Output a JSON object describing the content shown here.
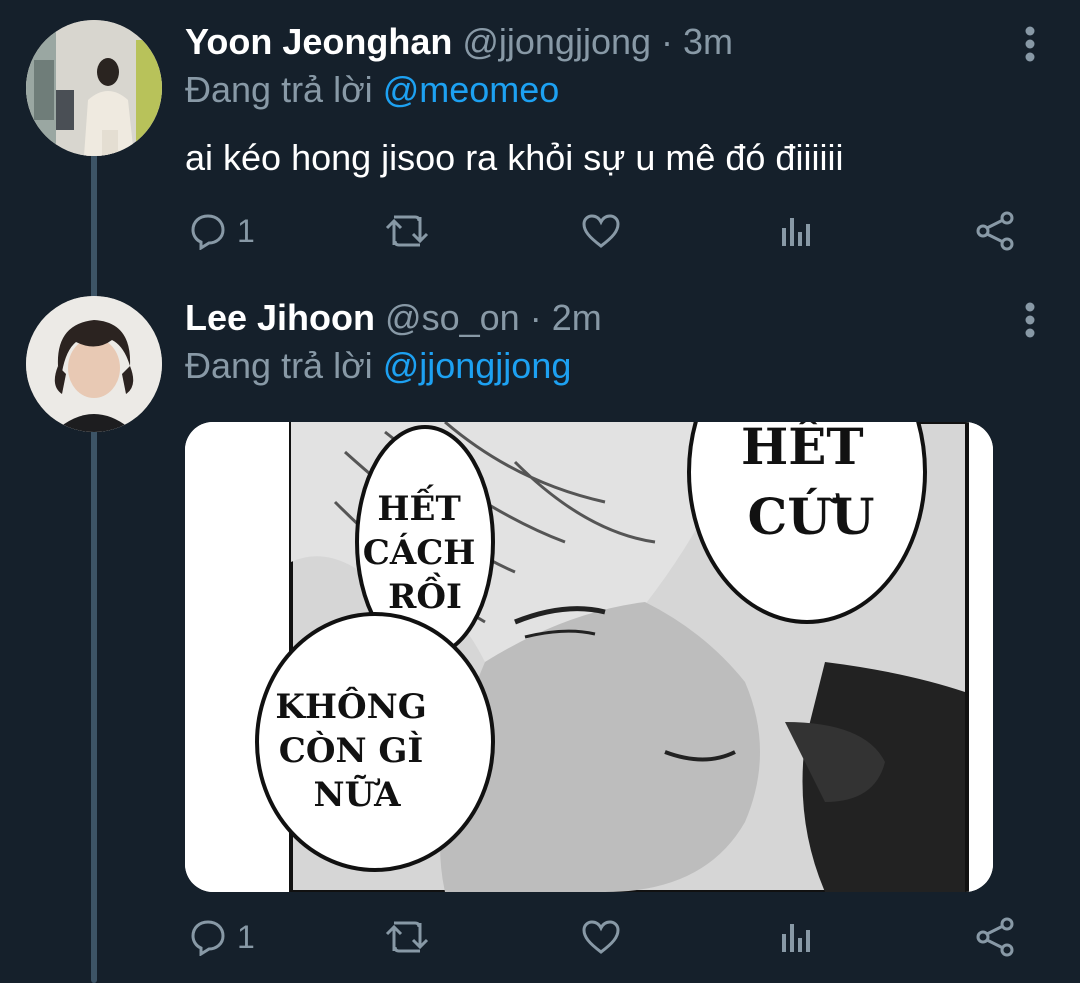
{
  "tweets": [
    {
      "name": "Yoon Jeonghan",
      "handle": "@jjongjjong",
      "time": "· 3m",
      "reply_prefix": "Đang trả lời",
      "reply_to": "@meomeo",
      "text": "ai kéo hong jisoo ra khỏi sự u mê đó điiiiii",
      "reply_count": "1"
    },
    {
      "name": "Lee Jihoon",
      "handle": "@so_on",
      "time": "· 2m",
      "reply_prefix": "Đang trả lời",
      "reply_to": "@jjongjjong",
      "reply_count": "1",
      "media": {
        "bubble_1": [
          "HẾT",
          "CÁCH",
          "RỒI"
        ],
        "bubble_2": [
          "KHÔNG",
          "CÒN GÌ",
          "NỮA"
        ],
        "bubble_3": [
          "HẾT",
          "CỨU"
        ]
      }
    }
  ],
  "colors": {
    "background": "#15202b",
    "secondary_text": "#8899a6",
    "link": "#1da1f2",
    "thread_line": "#3d5466"
  },
  "icons": [
    "more-vertical-icon",
    "reply-icon",
    "retweet-icon",
    "like-icon",
    "analytics-icon",
    "share-icon"
  ]
}
